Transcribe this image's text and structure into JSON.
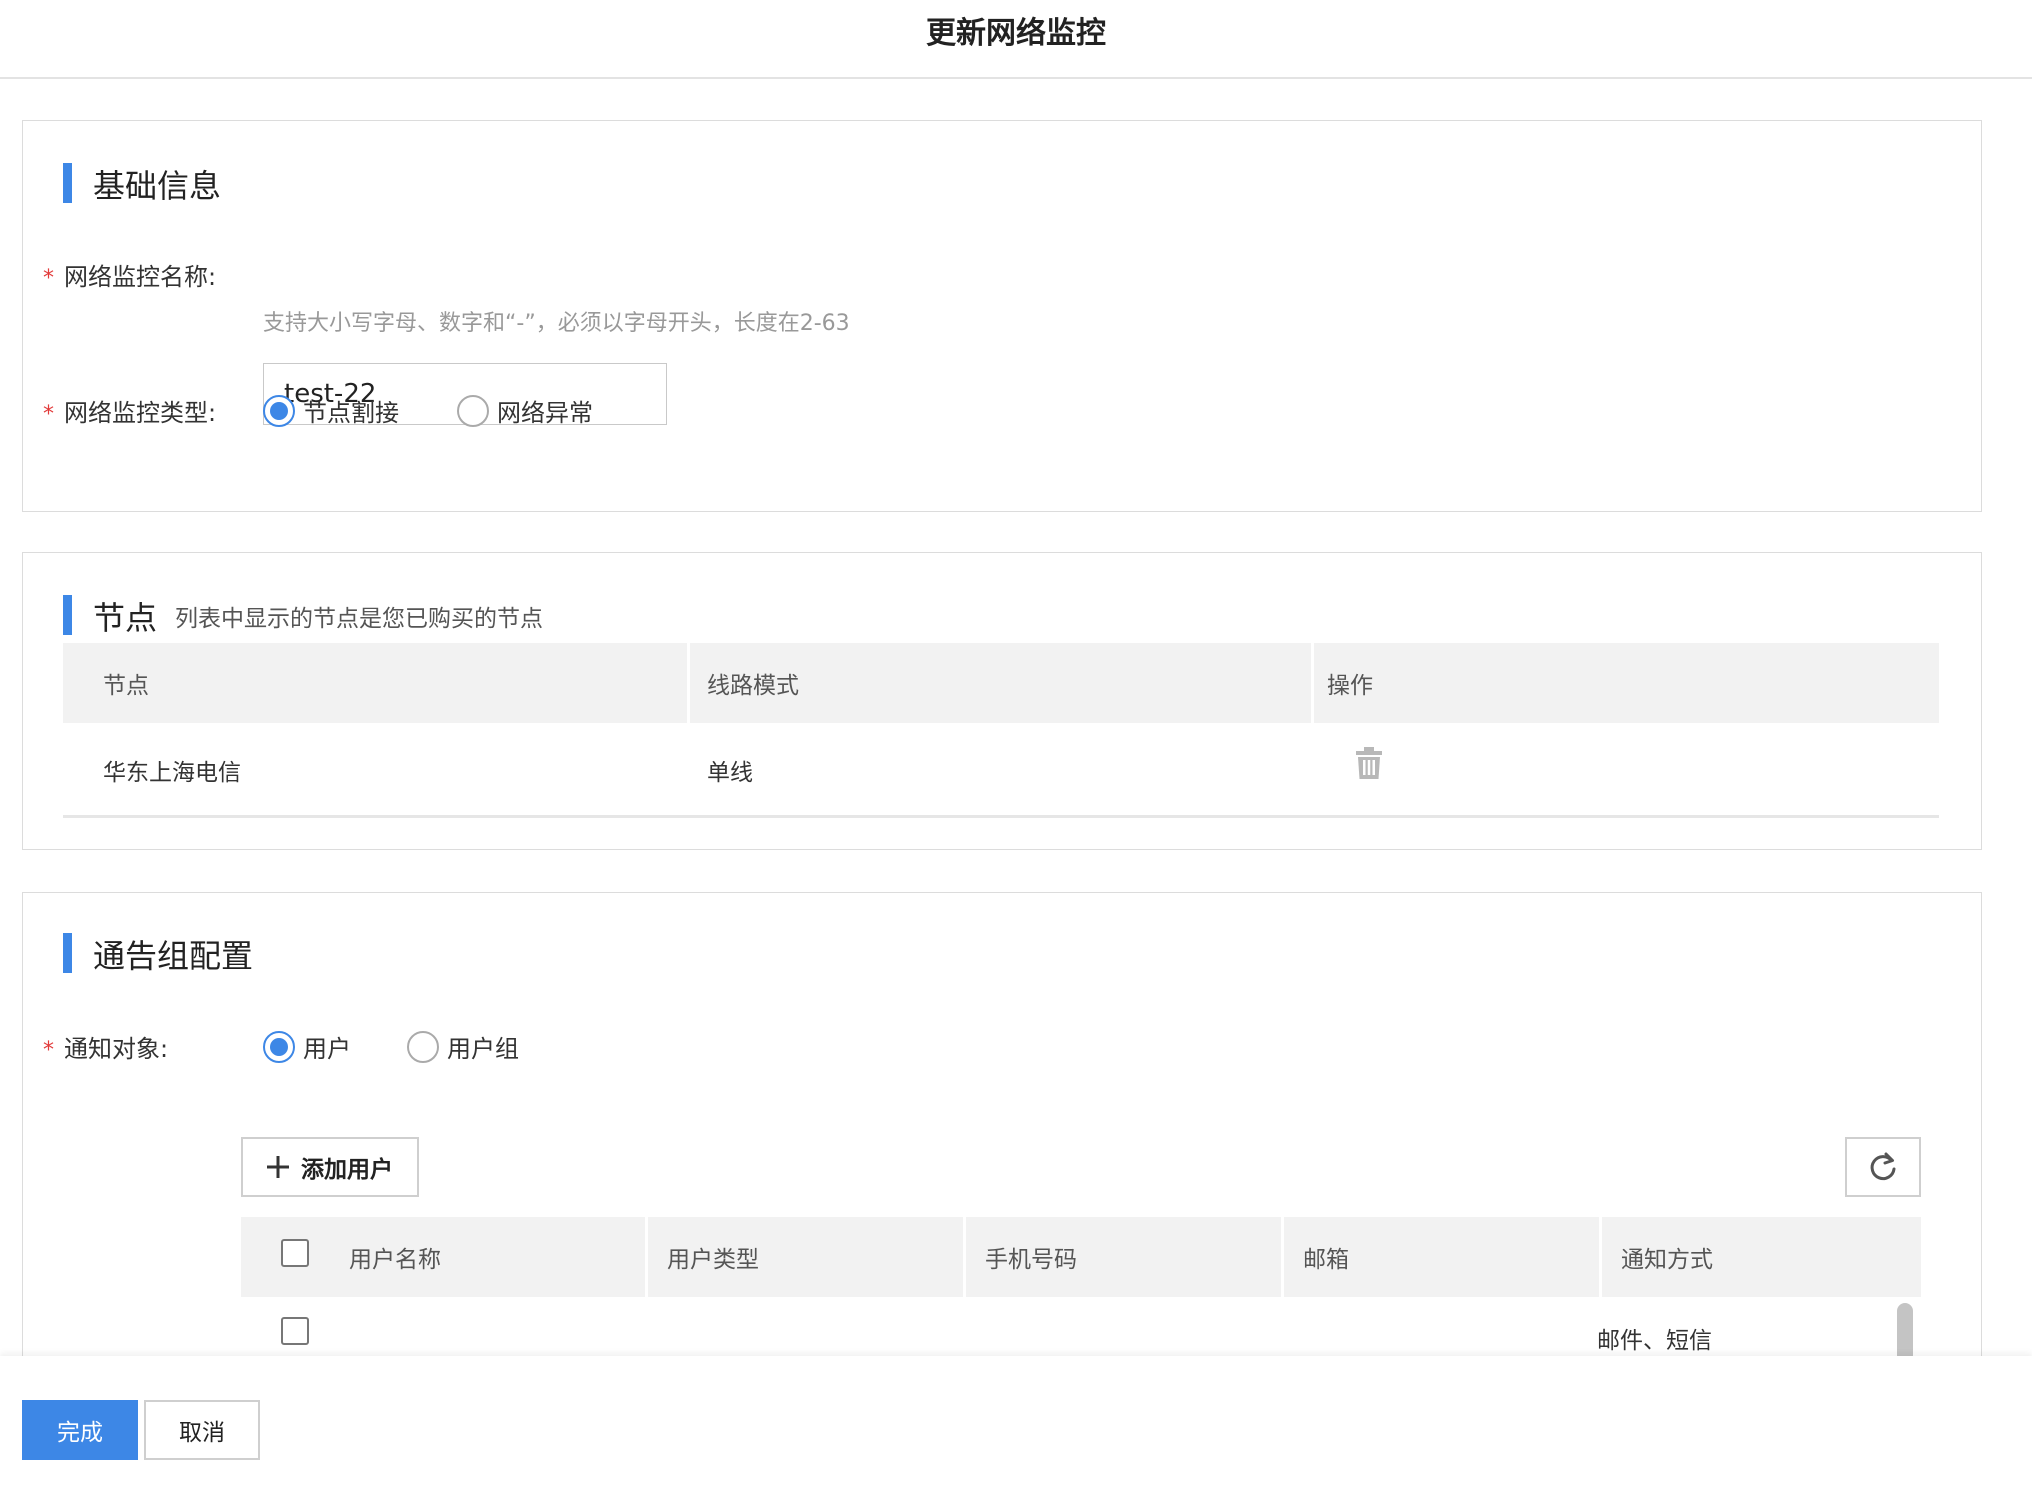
{
  "header": {
    "title": "更新网络监控"
  },
  "basic": {
    "title": "基础信息",
    "required_mark": "*",
    "name_label": "网络监控名称:",
    "name_value": "test-22",
    "name_hint": "支持大小写字母、数字和“-”，必须以字母开头，长度在2-63",
    "type_label": "网络监控类型:",
    "type_options": [
      {
        "label": "节点割接",
        "checked": true
      },
      {
        "label": "网络异常",
        "checked": false
      }
    ]
  },
  "nodes": {
    "title": "节点",
    "subtitle": "列表中显示的节点是您已购买的节点",
    "columns": [
      "节点",
      "线路模式",
      "操作"
    ],
    "rows": [
      {
        "node": "华东上海电信",
        "mode": "单线",
        "action_icon": "trash-icon"
      }
    ]
  },
  "notify": {
    "title": "通告组配置",
    "required_mark": "*",
    "target_label": "通知对象:",
    "target_options": [
      {
        "label": "用户",
        "checked": true
      },
      {
        "label": "用户组",
        "checked": false
      }
    ],
    "add_user_label": "添加用户",
    "refresh_icon": "refresh-icon",
    "columns": [
      "用户名称",
      "用户类型",
      "手机号码",
      "邮箱",
      "通知方式"
    ],
    "rows": [
      {
        "name": "",
        "type": "",
        "phone": "",
        "email": "",
        "method": "邮件、短信"
      }
    ]
  },
  "footer": {
    "done_label": "完成",
    "cancel_label": "取消"
  },
  "colors": {
    "accent": "#3d87e6",
    "required": "#e23b3b"
  }
}
